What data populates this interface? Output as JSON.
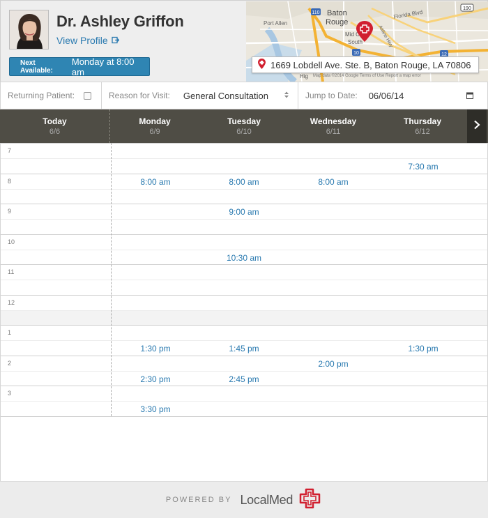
{
  "doctor": {
    "name": "Dr. Ashley Griffon",
    "view_profile": "View Profile"
  },
  "next_available": {
    "label": "Next Available:",
    "value": "Monday at 8:00 am"
  },
  "map": {
    "address": "1669 Lobdell Ave. Ste. B, Baton Rouge, LA 70806",
    "labels": {
      "city": "Baton",
      "city2": "Rouge",
      "port_allen": "Port Allen",
      "florida_blvd": "Florida Blvd",
      "mid_city": "Mid C",
      "south": "South",
      "airline_hwy": "Airline Hwy",
      "i110": "110",
      "i12": "12",
      "i10": "10",
      "us190": "190",
      "attribution": "Map data ©2014 Google   Terms of Use   Report a map error",
      "hig": "Hig"
    },
    "colors": {
      "road_major": "#f3b233",
      "road_minor": "#ffffff",
      "pin": "#d11f2f"
    }
  },
  "filters": {
    "returning_label": "Returning Patient:",
    "reason_label": "Reason for Visit:",
    "reason_value": "General Consultation",
    "jump_label": "Jump to Date:",
    "jump_value": "06/06/14"
  },
  "days": [
    {
      "name": "Today",
      "date": "6/6"
    },
    {
      "name": "Monday",
      "date": "6/9"
    },
    {
      "name": "Tuesday",
      "date": "6/10"
    },
    {
      "name": "Wednesday",
      "date": "6/11"
    },
    {
      "name": "Thursday",
      "date": "6/12"
    }
  ],
  "hours": [
    "7",
    "8",
    "9",
    "10",
    "11",
    "12",
    "1",
    "2",
    "3"
  ],
  "slots": {
    "mon_800": "8:00 am",
    "tue_800": "8:00 am",
    "wed_800": "8:00 am",
    "thu_730": "7:30 am",
    "tue_900": "9:00 am",
    "tue_1030": "10:30 am",
    "mon_130": "1:30 pm",
    "tue_145": "1:45 pm",
    "thu_130": "1:30 pm",
    "wed_200": "2:00 pm",
    "mon_230": "2:30 pm",
    "tue_245": "2:45 pm",
    "mon_330": "3:30 pm"
  },
  "footer": {
    "powered_by": "POWERED BY",
    "brand": "LocalMed"
  },
  "colors": {
    "accent": "#2f85b3",
    "link": "#2a7ab0",
    "day_header_bg": "#4f4d45",
    "brand_red": "#d11f2f"
  }
}
